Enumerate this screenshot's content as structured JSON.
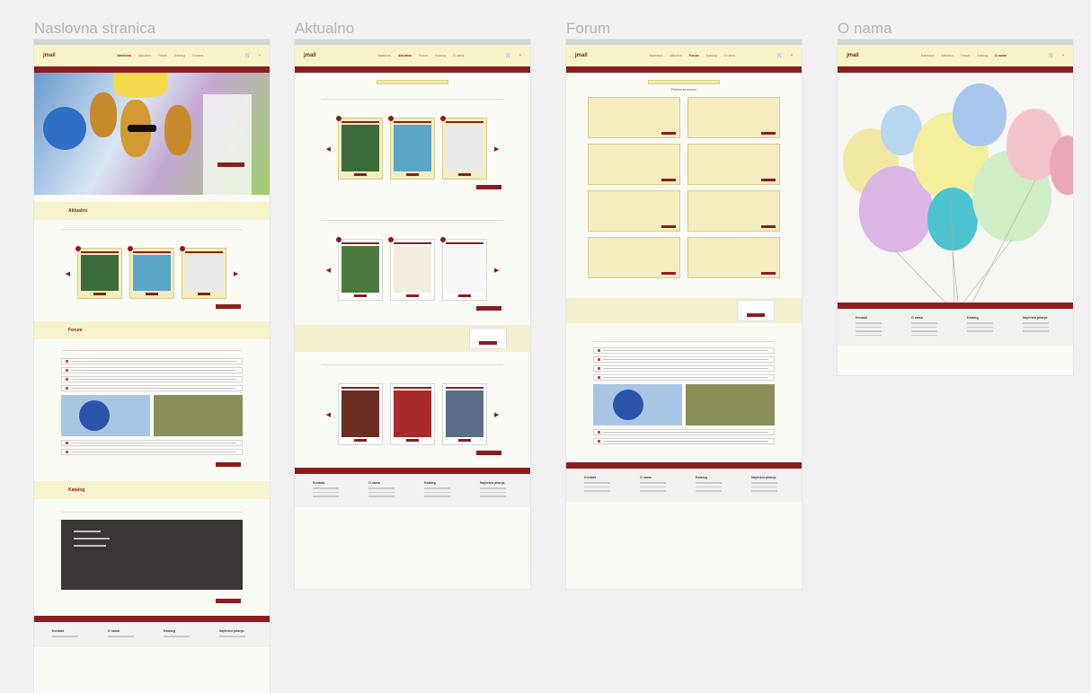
{
  "frames": [
    {
      "id": "naslovna",
      "title": "Naslovna stranica"
    },
    {
      "id": "aktualno",
      "title": "Aktualno"
    },
    {
      "id": "forum",
      "title": "Forum"
    },
    {
      "id": "onama",
      "title": "O nama"
    }
  ],
  "nav": {
    "logo": "jmail",
    "links": [
      "Naslovna",
      "Aktualno",
      "Forum",
      "Katalog",
      "O nama"
    ]
  },
  "naslovna": {
    "sections": [
      "Aktualno",
      "Forum",
      "Katalog"
    ]
  },
  "forum_page": {
    "heading": "Pridruži se forumu"
  },
  "footer": {
    "columns": [
      "Kontakt",
      "O nama",
      "Katalog",
      "Najčešća pitanja"
    ]
  },
  "colors": {
    "accent": "#8b1d20",
    "cream": "#f7f3c8",
    "background": "#f1f1f1"
  }
}
